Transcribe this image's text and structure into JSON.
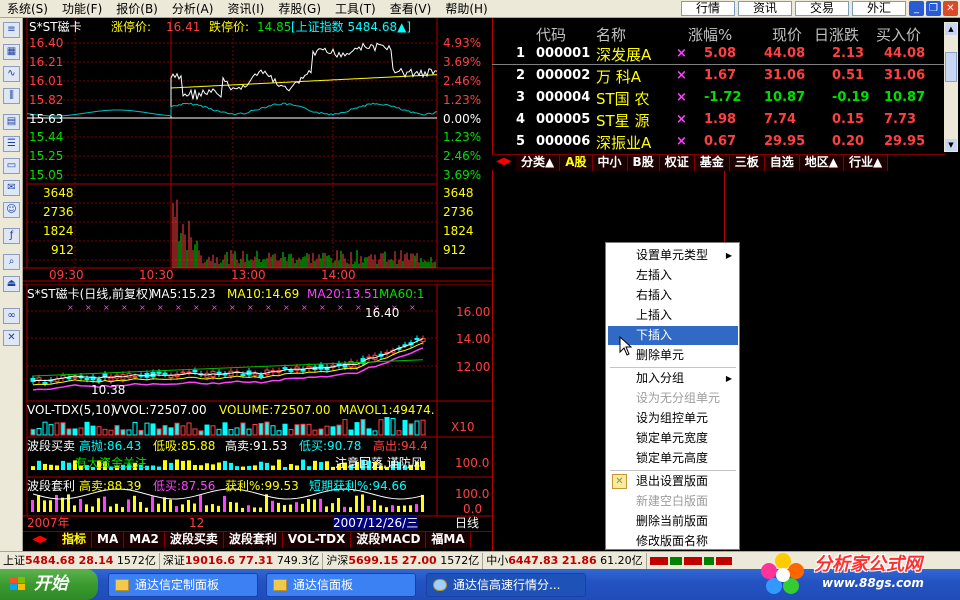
{
  "menu": [
    "系统(S)",
    "功能(F)",
    "报价(B)",
    "分析(A)",
    "资讯(I)",
    "荐股(G)",
    "工具(T)",
    "查看(V)",
    "帮助(H)"
  ],
  "top_buttons": [
    "行情",
    "资讯",
    "交易",
    "外汇"
  ],
  "window_buttons": {
    "minimize": "_",
    "restore": "❐",
    "close": "✕"
  },
  "intraday": {
    "title": "S*ST磁卡",
    "limit_up_label": "涨停价:",
    "limit_up": "16.41",
    "limit_down_label": "跌停价:",
    "limit_down": "14.85",
    "index_label": "[上证指数 5484.68▲]",
    "price_ticks": [
      "16.40",
      "16.21",
      "16.01",
      "15.82",
      "15.63",
      "15.44",
      "15.25",
      "15.05"
    ],
    "pct_ticks": [
      "4.93%",
      "3.69%",
      "2.46%",
      "1.23%",
      "0.00%",
      "1.23%",
      "2.46%",
      "3.69%"
    ],
    "vol_ticks": [
      "3648",
      "2736",
      "1824",
      "912"
    ],
    "time_ticks": [
      "09:30",
      "10:30",
      "13:00",
      "14:00"
    ]
  },
  "kline": {
    "title": "S*ST磁卡(日线,前复权)",
    "ma5": "MA5:15.23",
    "ma10": "MA10:14.69",
    "ma20": "MA20:13.51",
    "ma60": "MA60:1",
    "price_ticks": [
      "16.00",
      "14.00",
      "12.00"
    ],
    "high_label": "16.40",
    "low_label": "10.38",
    "vol_title": "VOL-TDX(5,10)",
    "vol_value": "VVOL:72507.00",
    "volume": "VOLUME:72507.00",
    "mavol": "MAVOL1:49474.",
    "vol_scale": "X10",
    "ind1_title": "波段买卖",
    "ind1_a": "高抛:86.43",
    "ind1_b": "低吸:85.88",
    "ind1_c": "高卖:91.53",
    "ind1_d": "低买:90.78",
    "ind1_e": "高出:94.4",
    "ind1_note1": "有大资金关注",
    "ind1_note2": "注意回落,谨防风",
    "ind1_scale": "100.0",
    "ind2_title": "波段套利",
    "ind2_a": "高卖:88.39",
    "ind2_b": "低买:87.56",
    "ind2_c": "获利%:99.53",
    "ind2_d": "短期获利%:94.66",
    "ind2_scale_a": "100.0",
    "ind2_scale_b": "0.0",
    "axis_year": "2007年",
    "axis_month": "12",
    "axis_date": "2007/12/26/三",
    "period": "日线"
  },
  "bottom_tabs": [
    "指标",
    "MA",
    "MA2",
    "波段买卖",
    "波段套利",
    "VOL-TDX",
    "波段MACD",
    "福MA"
  ],
  "stock_list": {
    "headers": [
      "代码",
      "名称",
      "涨幅%",
      "现价",
      "日涨跌",
      "买入价"
    ],
    "rows": [
      {
        "idx": "1",
        "code": "000001",
        "name": "深发展A",
        "pct": "5.08",
        "price": "44.08",
        "chg": "2.13",
        "bid": "44.08",
        "up": true
      },
      {
        "idx": "2",
        "code": "000002",
        "name": "万 科A",
        "pct": "1.67",
        "price": "31.06",
        "chg": "0.51",
        "bid": "31.06",
        "up": true
      },
      {
        "idx": "3",
        "code": "000004",
        "name": "ST国 农",
        "pct": "-1.72",
        "price": "10.87",
        "chg": "-0.19",
        "bid": "10.87",
        "up": false
      },
      {
        "idx": "4",
        "code": "000005",
        "name": "ST星 源",
        "pct": "1.98",
        "price": "7.74",
        "chg": "0.15",
        "bid": "7.73",
        "up": true
      },
      {
        "idx": "5",
        "code": "000006",
        "name": "深振业A",
        "pct": "0.67",
        "price": "29.95",
        "chg": "0.20",
        "bid": "29.95",
        "up": true
      }
    ],
    "marker": "×"
  },
  "category_tabs": [
    "分类▲",
    "A股",
    "中小",
    "B股",
    "权证",
    "基金",
    "三板",
    "自选",
    "地区▲",
    "行业▲"
  ],
  "context_menu": {
    "items": [
      {
        "label": "设置单元类型",
        "submenu": true,
        "disabled": false
      },
      {
        "label": "左插入",
        "disabled": false
      },
      {
        "label": "右插入",
        "disabled": false
      },
      {
        "label": "上插入",
        "disabled": false
      },
      {
        "label": "下插入",
        "disabled": false,
        "selected": true
      },
      {
        "label": "删除单元",
        "disabled": false
      },
      {
        "label": "加入分组",
        "submenu": true,
        "disabled": false
      },
      {
        "label": "设为无分组单元",
        "disabled": true
      },
      {
        "label": "设为组控单元",
        "disabled": false
      },
      {
        "label": "锁定单元宽度",
        "disabled": false
      },
      {
        "label": "锁定单元高度",
        "disabled": false
      },
      {
        "label": "退出设置版面",
        "disabled": false
      },
      {
        "label": "新建空白版面",
        "disabled": true
      },
      {
        "label": "删除当前版面",
        "disabled": false
      },
      {
        "label": "修改版面名称",
        "disabled": false
      }
    ]
  },
  "status_bar": {
    "sh_label": "上证",
    "sh_value": "5484.68",
    "sh_chg": "28.14",
    "sh_amt": "1572亿",
    "sz_label": "深证",
    "sz_value": "19016.6",
    "sz_chg": "77.31",
    "sz_amt": "749.3亿",
    "hs_label": "沪深",
    "hs_value": "5699.15",
    "hs_chg": "27.00",
    "hs_amt": "1572亿",
    "zx_label": "中小",
    "zx_value": "6447.83",
    "zx_chg": "21.86",
    "zx_amt": "61.20亿"
  },
  "taskbar": {
    "start": "开始",
    "tasks": [
      "通达信定制面板",
      "通达信面板",
      "通达信高速行情分..."
    ]
  },
  "logo": {
    "name": "分析家公式网",
    "url": "www.88gs.com"
  }
}
